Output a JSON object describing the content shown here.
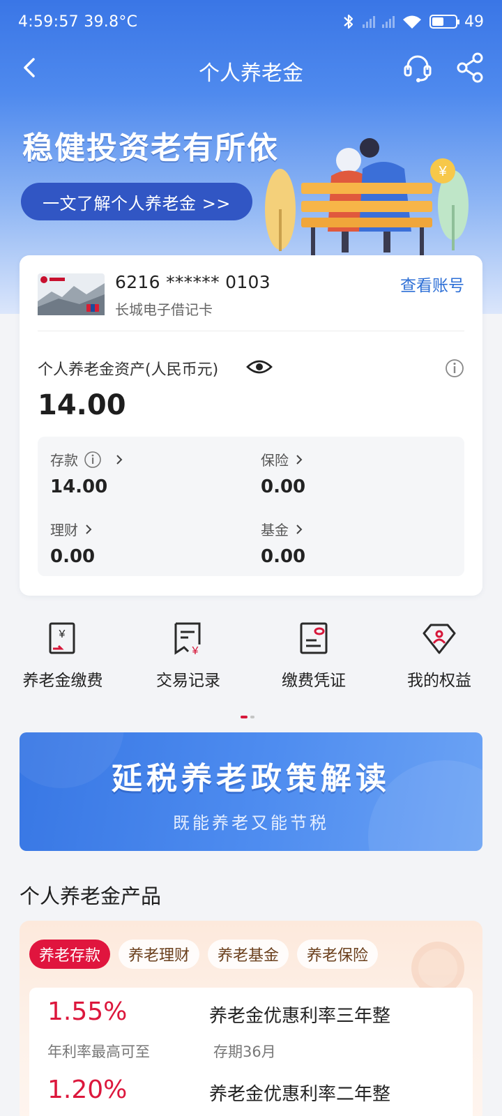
{
  "status_bar": {
    "time_temp": "4:59:57 39.8°C",
    "battery": "49"
  },
  "nav": {
    "title": "个人养老金"
  },
  "hero": {
    "slogan": "稳健投资老有所依",
    "learn_button": "一文了解个人养老金 >>"
  },
  "account": {
    "card_number": "6216 ****** 0103",
    "card_type": "长城电子借记卡",
    "view_account": "查看账号",
    "asset_label": "个人养老金资产(人民币元)",
    "asset_total": "14.00",
    "breakdown": [
      {
        "label": "存款",
        "value": "14.00"
      },
      {
        "label": "保险",
        "value": "0.00"
      },
      {
        "label": "理财",
        "value": "0.00"
      },
      {
        "label": "基金",
        "value": "0.00"
      }
    ]
  },
  "quick_actions": [
    {
      "label": "养老金缴费",
      "icon": "receipt-yuan-icon"
    },
    {
      "label": "交易记录",
      "icon": "transaction-record-icon"
    },
    {
      "label": "缴费凭证",
      "icon": "payment-voucher-icon"
    },
    {
      "label": "我的权益",
      "icon": "diamond-benefits-icon"
    }
  ],
  "policy_banner": {
    "title": "延税养老政策解读",
    "subtitle": "既能养老又能节税"
  },
  "products": {
    "section_title": "个人养老金产品",
    "tabs": [
      "养老存款",
      "养老理财",
      "养老基金",
      "养老保险"
    ],
    "active_tab": 0,
    "items": [
      {
        "rate": "1.55%",
        "name": "养老金优惠利率三年整",
        "desc": "年利率最高可至",
        "term": "存期36月"
      },
      {
        "rate": "1.20%",
        "name": "养老金优惠利率二年整"
      }
    ]
  },
  "colors": {
    "brand_blue": "#3a76e6",
    "accent_red": "#dc173c",
    "link_blue": "#2d6fd6"
  }
}
